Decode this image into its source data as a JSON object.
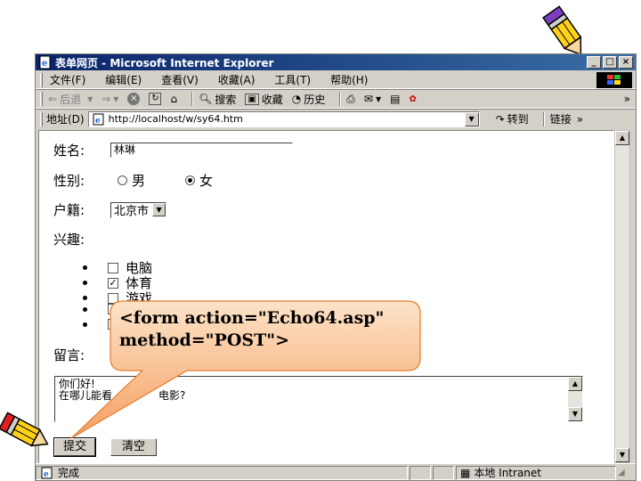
{
  "window": {
    "title": "表单网页 - Microsoft Internet Explorer",
    "controls": {
      "minimize": "_",
      "maximize": "□",
      "close": "×"
    }
  },
  "menu": [
    "文件(F)",
    "编辑(E)",
    "查看(V)",
    "收藏(A)",
    "工具(T)",
    "帮助(H)"
  ],
  "toolbar": {
    "back": "后退",
    "search": "搜索",
    "favorites": "收藏",
    "history": "历史",
    "more": "»"
  },
  "address": {
    "label": "地址(D)",
    "url": "http://localhost/w/sy64.htm",
    "go": "转到",
    "links": "链接",
    "more": "»"
  },
  "form": {
    "name_label": "姓名:",
    "name_value": "林琳",
    "gender_label": "性别:",
    "gender_male": "男",
    "gender_female": "女",
    "origin_label": "户籍:",
    "origin_value": "北京市",
    "interest_label": "兴趣:",
    "interests": [
      {
        "label": "电脑",
        "checked": false
      },
      {
        "label": "体育",
        "checked": true
      },
      {
        "label": "游戏",
        "checked": false
      }
    ],
    "message_label": "留言:",
    "message_line1": "你们好!",
    "message_line2a": "在哪儿能看",
    "message_line2b": "电影?",
    "submit_label": "提交",
    "reset_label": "清空"
  },
  "status": {
    "done": "完成",
    "zone": "本地 Intranet"
  },
  "callout": {
    "line1": "<form  action=\"Echo64.asp\"",
    "line2": "method=\"POST\">"
  },
  "colors": {
    "titlebar": "#0a246a",
    "chrome": "#d4d0c8",
    "callout_fill_top": "#fde3c8",
    "callout_fill_bottom": "#f5a062"
  }
}
